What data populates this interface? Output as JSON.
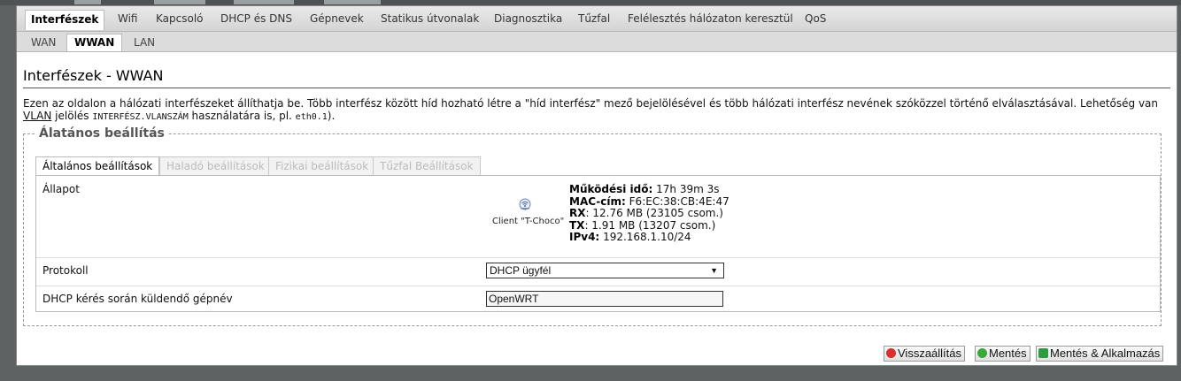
{
  "top_tabs": [
    "Interfészek",
    "Wifi",
    "Kapcsoló",
    "DHCP és DNS",
    "Gépnevek",
    "Statikus útvonalak",
    "Diagnosztika",
    "Tűzfal",
    "Felélesztés hálózaton keresztül",
    "QoS"
  ],
  "sub_tabs": [
    "WAN",
    "WWAN",
    "LAN"
  ],
  "page": {
    "title": "Interfészek - WWAN",
    "desc_1": "Ezen az oldalon a hálózati interfészeket állíthatja be. Több interfész között híd hozható létre a \"híd interfész\" mező bejelölésével és több hálózati interfész nevének szóközzel történő elválasztásával. Lehetőség van ",
    "desc_vlan": "VLAN",
    "desc_2": " jelölés ",
    "desc_code1": "INTERFÉSZ.VLANSZÁM",
    "desc_3": " használatára is, pl. ",
    "desc_code2": "eth0.1",
    "desc_4": ")."
  },
  "section": {
    "legend": "Álatános beállítás",
    "tabs": [
      "Általános beállítások",
      "Haladó beállítások",
      "Fizikai beállítások",
      "Tűzfal Beállítások"
    ]
  },
  "status": {
    "label": "Állapot",
    "client": "Client \"T-Choco\"",
    "uptime_label": "Működési idő:",
    "uptime": "17h 39m 3s",
    "mac_label": "MAC-cím:",
    "mac": "F6:EC:38:CB:4E:47",
    "rx_label": "RX",
    "rx": ": 12.76 MB (23105 csom.)",
    "tx_label": "TX",
    "tx": ": 1.91 MB (13207 csom.)",
    "ipv4_label": "IPv4:",
    "ipv4": "192.168.1.10/24"
  },
  "protocol": {
    "label": "Protokoll",
    "value": "DHCP ügyfél"
  },
  "hostname": {
    "label": "DHCP kérés során küldendő gépnév",
    "value": "OpenWRT"
  },
  "buttons": {
    "reset": "Visszaállítás",
    "save": "Mentés",
    "save_apply": "Mentés & Alkalmazás"
  },
  "colors": {
    "accent": "#000000",
    "reset_icon": "#d9302b",
    "save_icon": "#3aa83a",
    "apply_icon": "#2e9b3e"
  }
}
